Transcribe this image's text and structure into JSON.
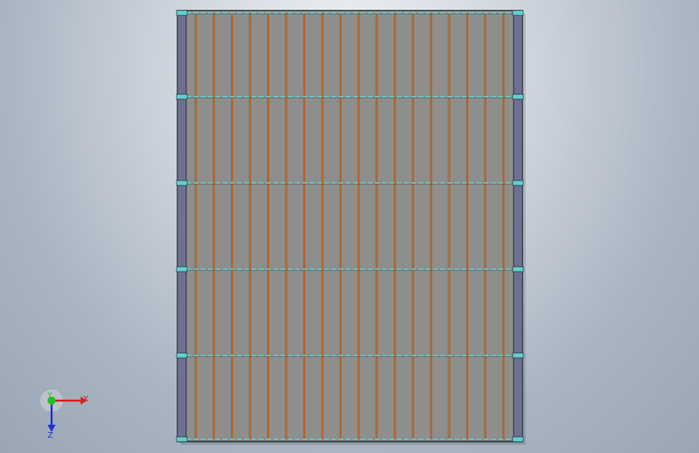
{
  "viewport": {
    "background_top": "#f2f4f7",
    "background_bottom": "#9aa6b4"
  },
  "model": {
    "panel_fill": "#8e8f8c",
    "slat_color": "#b8662c",
    "beam_color": "#5fd1cf",
    "outline_color": "#1a1f2a",
    "side_rail_color": "#6d7090",
    "slat_count": 18,
    "beam_count": 6
  },
  "triad": {
    "x_label": "X",
    "y_label": "Y",
    "z_label": "Z",
    "x_color": "#d82020",
    "y_color": "#20c020",
    "z_color": "#2030d8"
  }
}
